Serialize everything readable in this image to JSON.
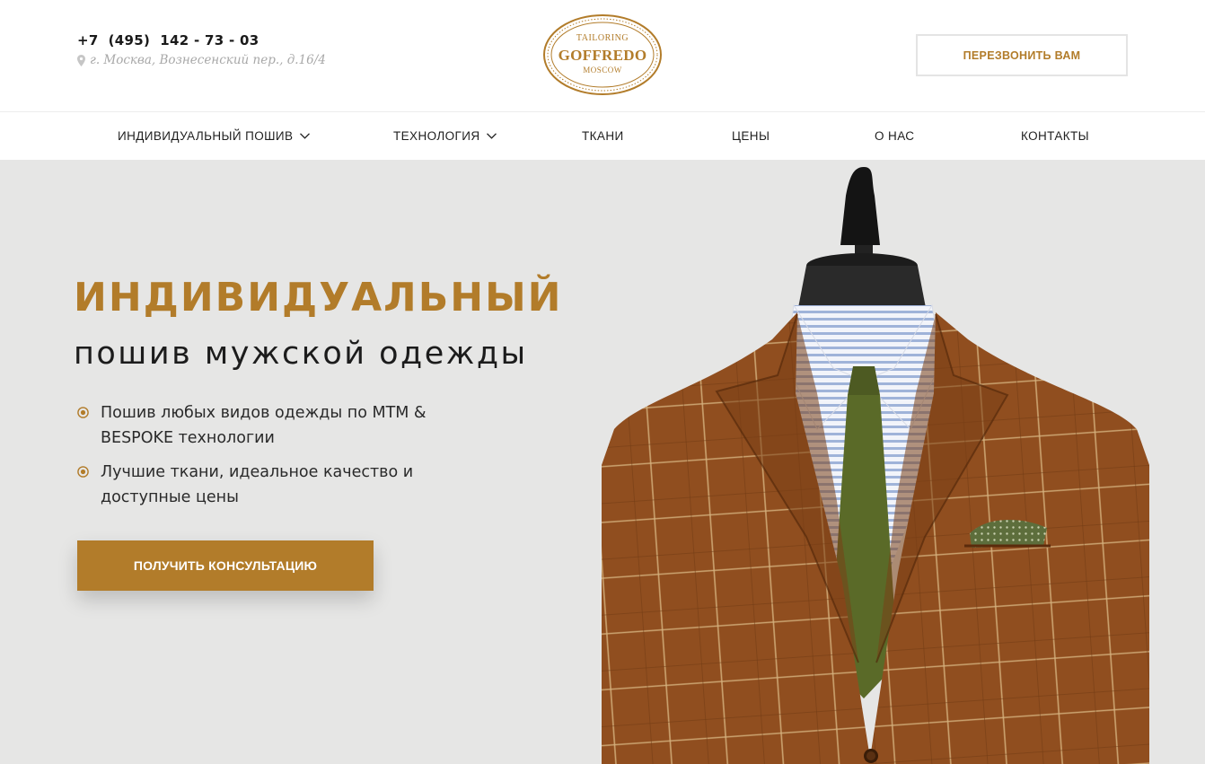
{
  "header": {
    "phone": "+7  (495)  142 - 73 - 03",
    "address": "г. Москва, Вознесенский пер., д.16/4",
    "callback_label": "ПЕРЕЗВОНИТЬ ВАМ",
    "logo": {
      "top": "TAILORING",
      "main": "GOFFREDO",
      "bottom": "MOSCOW"
    }
  },
  "nav": {
    "items": [
      {
        "label": "ИНДИВИДУАЛЬНЫЙ ПОШИВ",
        "dropdown": true
      },
      {
        "label": "ТЕХНОЛОГИЯ",
        "dropdown": true
      },
      {
        "label": "ТКАНИ",
        "dropdown": false
      },
      {
        "label": "ЦЕНЫ",
        "dropdown": false
      },
      {
        "label": "О НАС",
        "dropdown": false
      },
      {
        "label": "КОНТАКТЫ",
        "dropdown": false
      }
    ]
  },
  "hero": {
    "title": "ИНДИВИДУАЛЬНЫЙ",
    "subtitle": "пошив мужской одежды",
    "bullets": [
      "Пошив любых видов одежды по MTM & BESPOKE технологии",
      "Лучшие ткани, идеальное качество и доступные цены"
    ],
    "cta_label": "ПОЛУЧИТЬ КОНСУЛЬТАЦИЮ"
  },
  "colors": {
    "accent": "#b27c2a",
    "hero_bg": "#e6e6e5",
    "text": "#1a1a1a",
    "muted": "#a8a8a8"
  },
  "icons": {
    "address": "map-pin-icon",
    "dropdown": "chevron-down-icon",
    "bullet": "radio-dot-icon"
  }
}
